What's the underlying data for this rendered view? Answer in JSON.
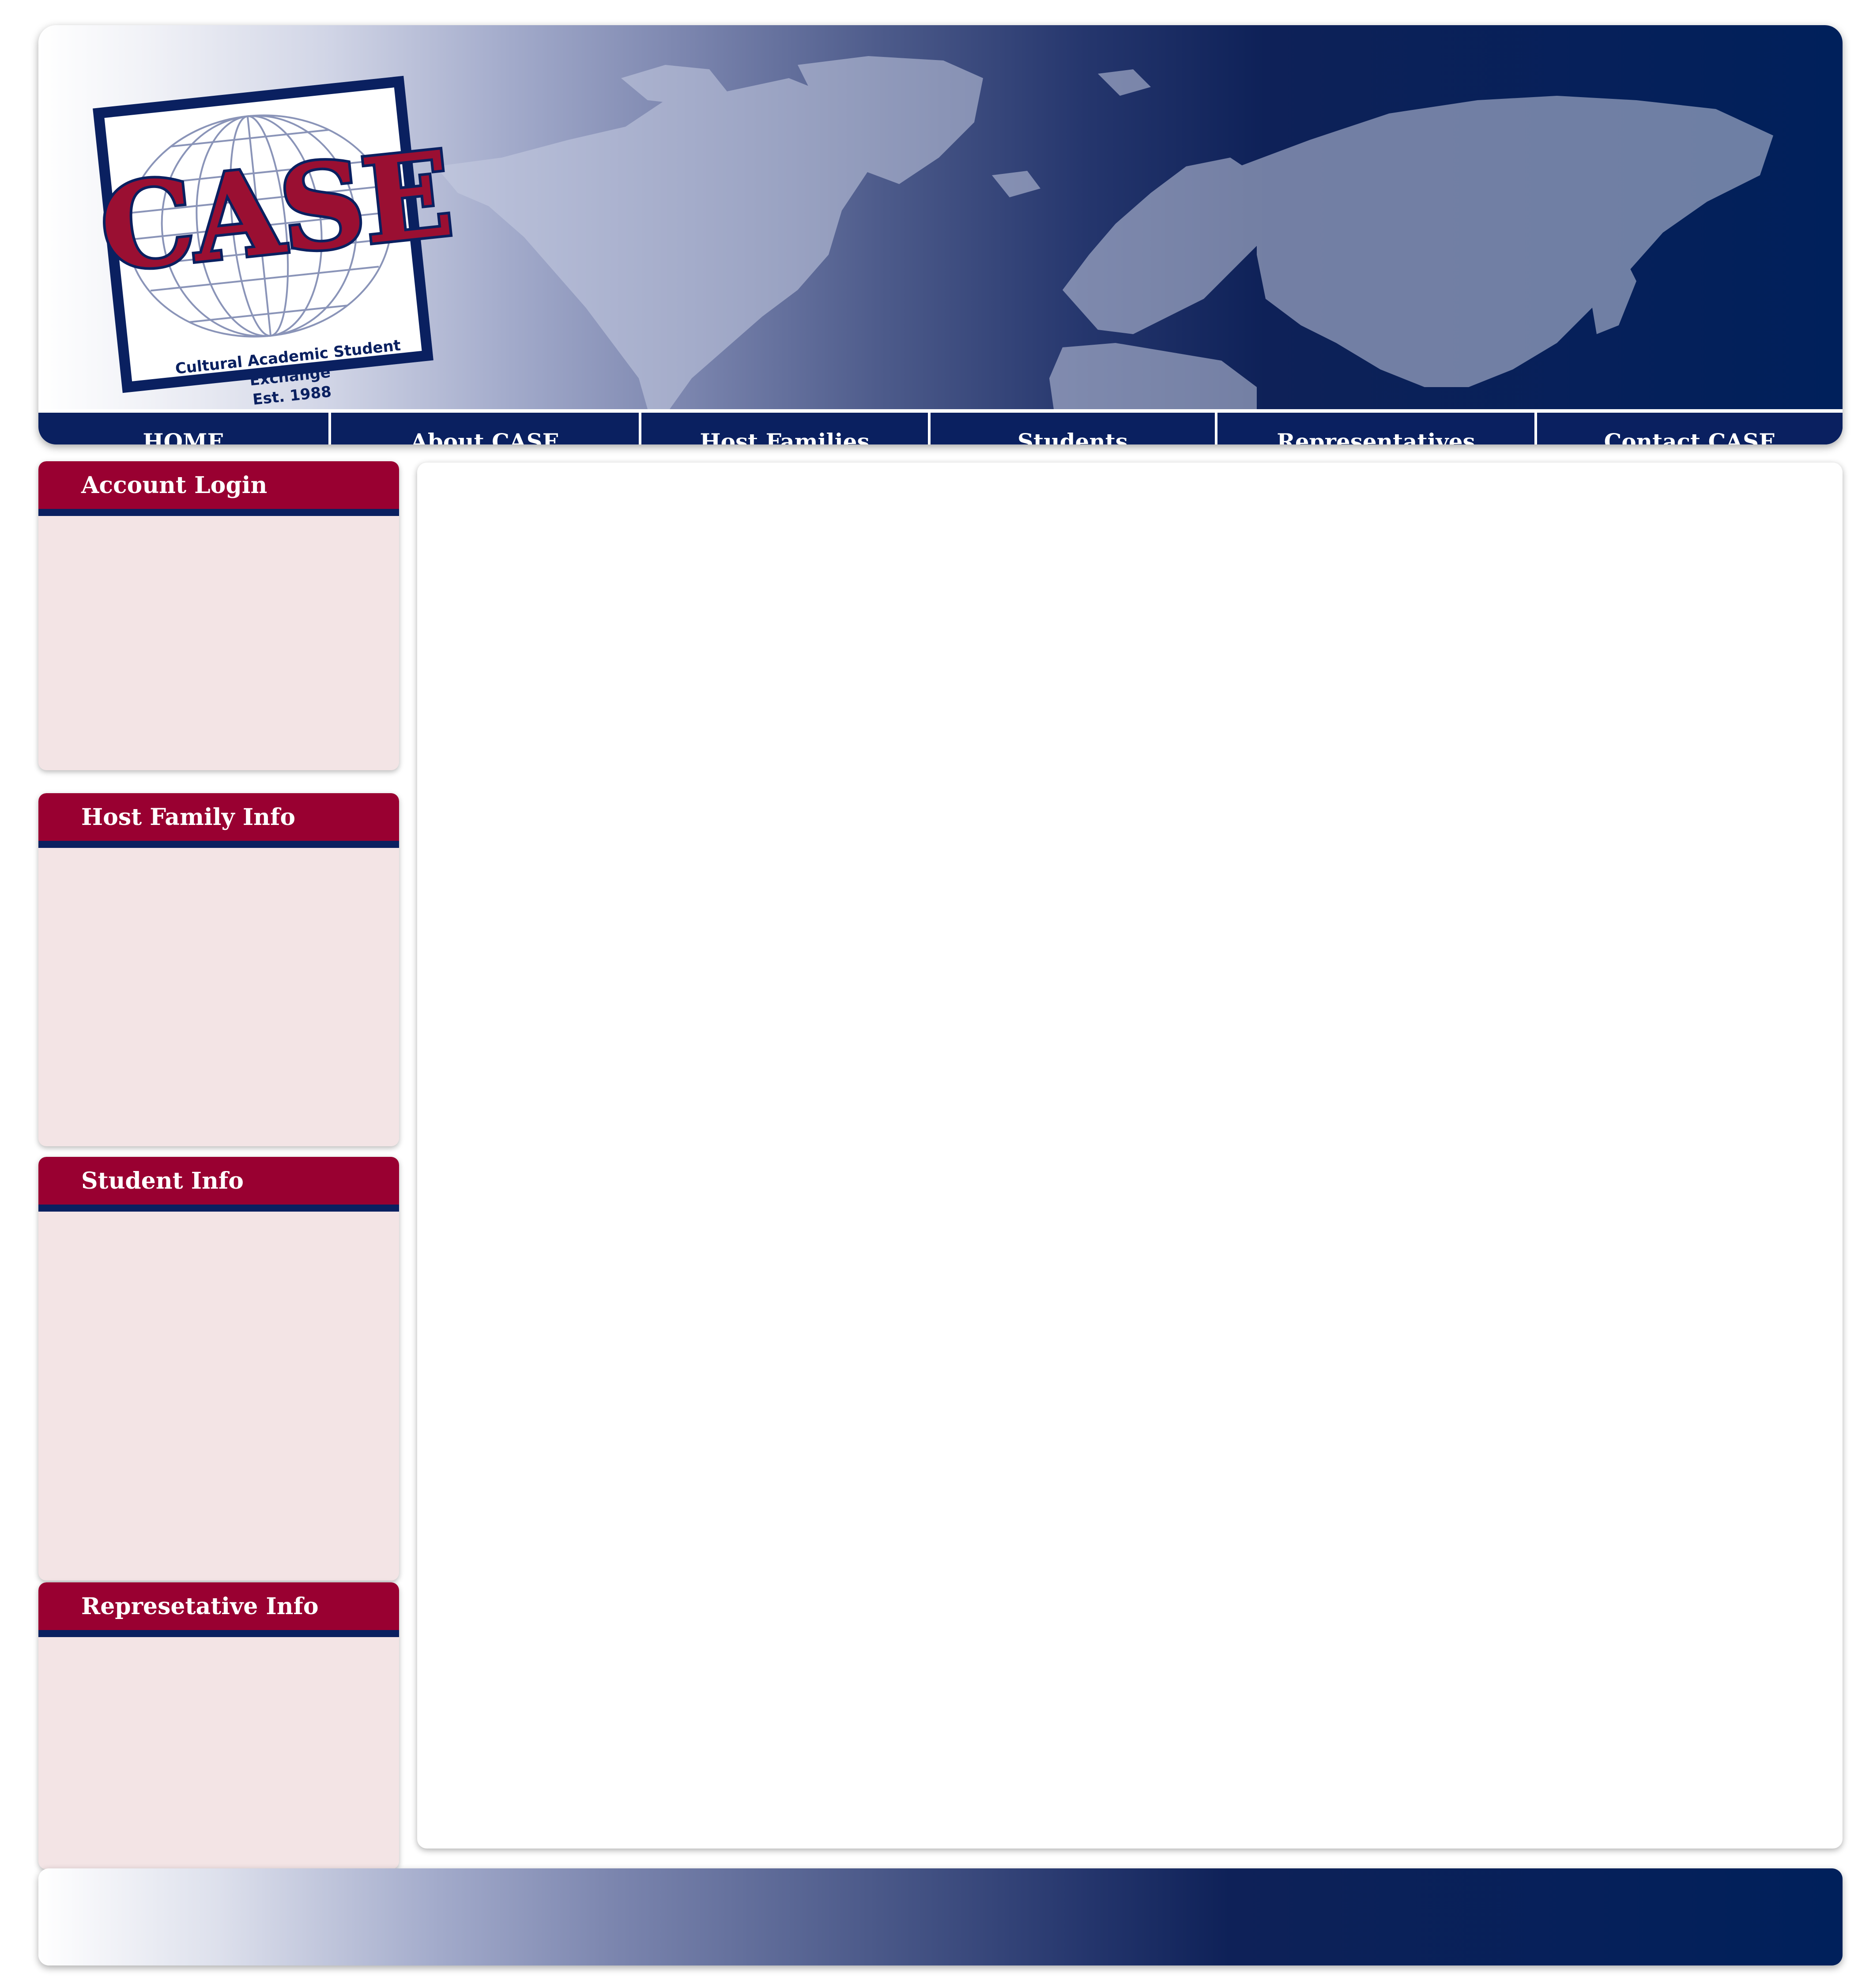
{
  "brand": {
    "logo_word": "CASE",
    "tagline_line1": "Cultural Academic Student Exchange",
    "tagline_line2": "Est. 1988"
  },
  "nav": {
    "items": [
      {
        "label": "HOME"
      },
      {
        "label": "About CASE"
      },
      {
        "label": "Host Families"
      },
      {
        "label": "Students"
      },
      {
        "label": "Representatives"
      },
      {
        "label": "Contact CASE"
      }
    ]
  },
  "sidebar": {
    "panels": [
      {
        "title": "Account Login"
      },
      {
        "title": "Host Family Info"
      },
      {
        "title": "Student Info"
      },
      {
        "title": "Represetative Info"
      }
    ]
  },
  "colors": {
    "navy": "#0a2060",
    "crimson": "#990031",
    "panel_bg": "#f3e4e5"
  }
}
